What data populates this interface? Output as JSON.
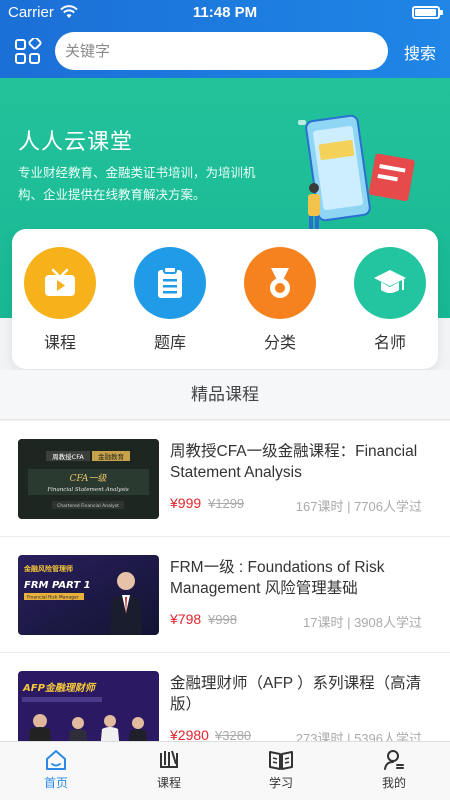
{
  "status": {
    "carrier": "Carrier",
    "time": "11:48 PM"
  },
  "header": {
    "search_placeholder": "关键字",
    "search_label": "搜索"
  },
  "banner": {
    "title": "人人云课堂",
    "description": "专业财经教育、金融类证书培训，为培训机构、企业提供在线教育解决方案。"
  },
  "categories": [
    {
      "label": "课程",
      "icon": "tv-play-icon",
      "color": "#f7b21b"
    },
    {
      "label": "题库",
      "icon": "clipboard-icon",
      "color": "#1f9be8"
    },
    {
      "label": "分类",
      "icon": "medal-icon",
      "color": "#f5821f"
    },
    {
      "label": "名师",
      "icon": "graduation-cap-icon",
      "color": "#22c59f"
    }
  ],
  "section": {
    "title": "精品课程"
  },
  "courses": [
    {
      "title": "周教授CFA一级金融课程：Financial Statement Analysis",
      "price": "¥999",
      "original_price": "¥1299",
      "meta": "167课时 | 7706人学过",
      "thumb": {
        "tag_left": "周教授CFA",
        "tag_right": "金融教育",
        "headline": "CFA一级",
        "sub": "Financial Statement Analysis",
        "foot": "Chartered Financial Analyst"
      }
    },
    {
      "title": "FRM一级 : Foundations of Risk Management 风险管理基础",
      "price": "¥798",
      "original_price": "¥998",
      "meta": "17课时 | 3908人学过",
      "thumb": {
        "tag": "金融风险管理师",
        "headline": "FRM PART 1",
        "sub": "Financial Risk Manager"
      }
    },
    {
      "title": "金融理财师（AFP ）系列课程（高清版）",
      "price": "¥2980",
      "original_price": "¥3280",
      "meta": "273课时 | 5396人学过",
      "thumb": {
        "headline": "AFP金融理财师"
      }
    }
  ],
  "tabbar": [
    {
      "label": "首页",
      "icon": "home-icon",
      "active": true
    },
    {
      "label": "课程",
      "icon": "book-icon",
      "active": false
    },
    {
      "label": "学习",
      "icon": "open-book-icon",
      "active": false
    },
    {
      "label": "我的",
      "icon": "user-icon",
      "active": false
    }
  ],
  "colors": {
    "accent": "#2a8be6",
    "banner": "#22c29b",
    "price": "#e0262d"
  }
}
